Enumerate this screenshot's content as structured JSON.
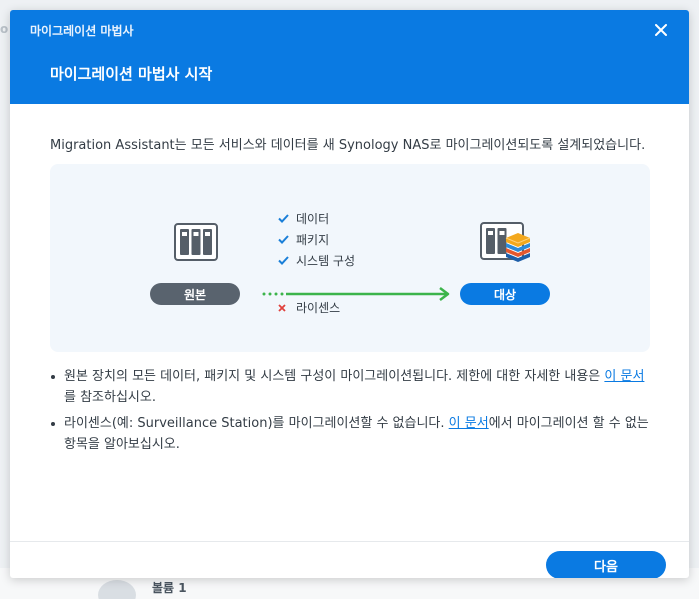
{
  "background": {
    "left_fragment": "o",
    "bottom_label": "볼륨 1"
  },
  "window": {
    "title": "마이그레이션 마법사"
  },
  "header": {
    "title": "마이그레이션 마법사 시작"
  },
  "intro": {
    "text": "Migration Assistant는 모든 서비스와 데이터를 새 Synology NAS로 마이그레이션되도록 설계되었습니다."
  },
  "diagram": {
    "source_label": "원본",
    "target_label": "대상",
    "included_items": [
      {
        "label": "데이터",
        "icon": "check-icon"
      },
      {
        "label": "패키지",
        "icon": "check-icon"
      },
      {
        "label": "시스템 구성",
        "icon": "check-icon"
      }
    ],
    "excluded_items": [
      {
        "label": "라이센스",
        "icon": "cross-icon"
      }
    ],
    "colors": {
      "check": "#1a7fd8",
      "cross": "#e0413d",
      "arrow": "#3cb44b",
      "source_pill": "#59636e",
      "target_pill": "#0a7ae2"
    }
  },
  "notes": [
    {
      "before": "원본 장치의 모든 데이터, 패키지 및 시스템 구성이 마이그레이션됩니다. 제한에 대한 자세한 내용은 ",
      "link": "이 문서",
      "after": "를 참조하십시오."
    },
    {
      "before": "라이센스(예: Surveillance Station)를 마이그레이션할 수 없습니다. ",
      "link": "이 문서",
      "after": "에서 마이그레이션 할 수 없는 항목을 알아보십시오."
    }
  ],
  "footer": {
    "next_label": "다음"
  }
}
